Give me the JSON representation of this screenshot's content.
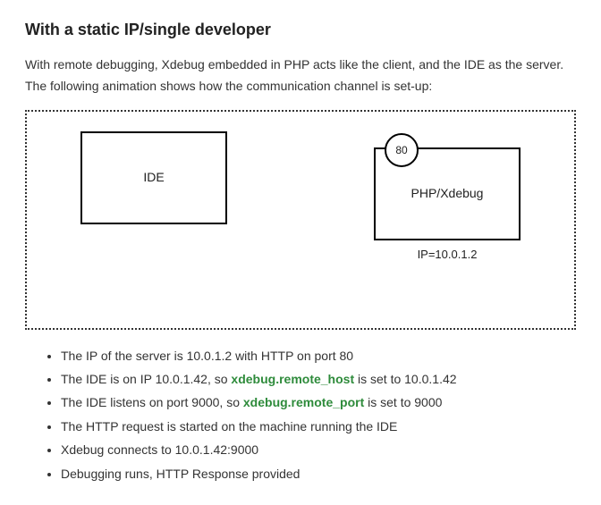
{
  "heading": "With a static IP/single developer",
  "intro": "With remote debugging, Xdebug embedded in PHP acts like the client, and the IDE as the server. The following animation shows how the communication channel is set-up:",
  "diagram": {
    "ide_label": "IDE",
    "php_label": "PHP/Xdebug",
    "port_label": "80",
    "ip_label": "IP=10.0.1.2"
  },
  "list": {
    "item1": "The IP of the server is 10.0.1.2 with HTTP on port 80",
    "item2_a": "The IDE is on IP 10.0.1.42, so ",
    "item2_cfg": "xdebug.remote_host",
    "item2_b": " is set to 10.0.1.42",
    "item3_a": "The IDE listens on port 9000, so ",
    "item3_cfg": "xdebug.remote_port",
    "item3_b": " is set to 9000",
    "item4": "The HTTP request is started on the machine running the IDE",
    "item5": "Xdebug connects to 10.0.1.42:9000",
    "item6": "Debugging runs, HTTP Response provided"
  }
}
